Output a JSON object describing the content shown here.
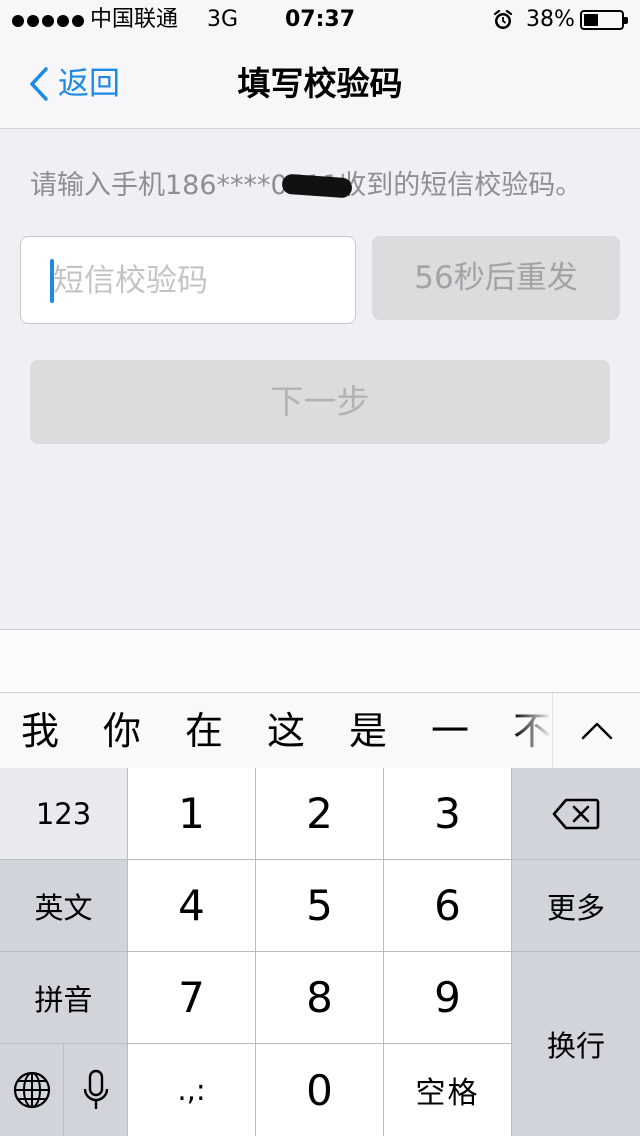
{
  "status_bar": {
    "carrier": "中国联通",
    "network": "3G",
    "time": "07:37",
    "battery_percent": "38%",
    "battery_level": 0.38
  },
  "nav": {
    "back_label": "返回",
    "title": "填写校验码"
  },
  "form": {
    "hint": "请输入手机186****0511收到的短信校验码。",
    "code_placeholder": "短信校验码",
    "resend_label": "56秒后重发",
    "next_label": "下一步"
  },
  "keyboard": {
    "candidates": [
      "我",
      "你",
      "在",
      "这",
      "是",
      "一",
      "不"
    ],
    "keys": {
      "mode_123": "123",
      "english": "英文",
      "pinyin": "拼音",
      "more": "更多",
      "return": "换行",
      "space": "空格",
      "punct": ".,:",
      "digits": [
        "1",
        "2",
        "3",
        "4",
        "5",
        "6",
        "7",
        "8",
        "9",
        "0"
      ]
    }
  },
  "colors": {
    "accent": "#1e8ae6",
    "background": "#efeff4",
    "disabled_button": "#dcdcde"
  }
}
